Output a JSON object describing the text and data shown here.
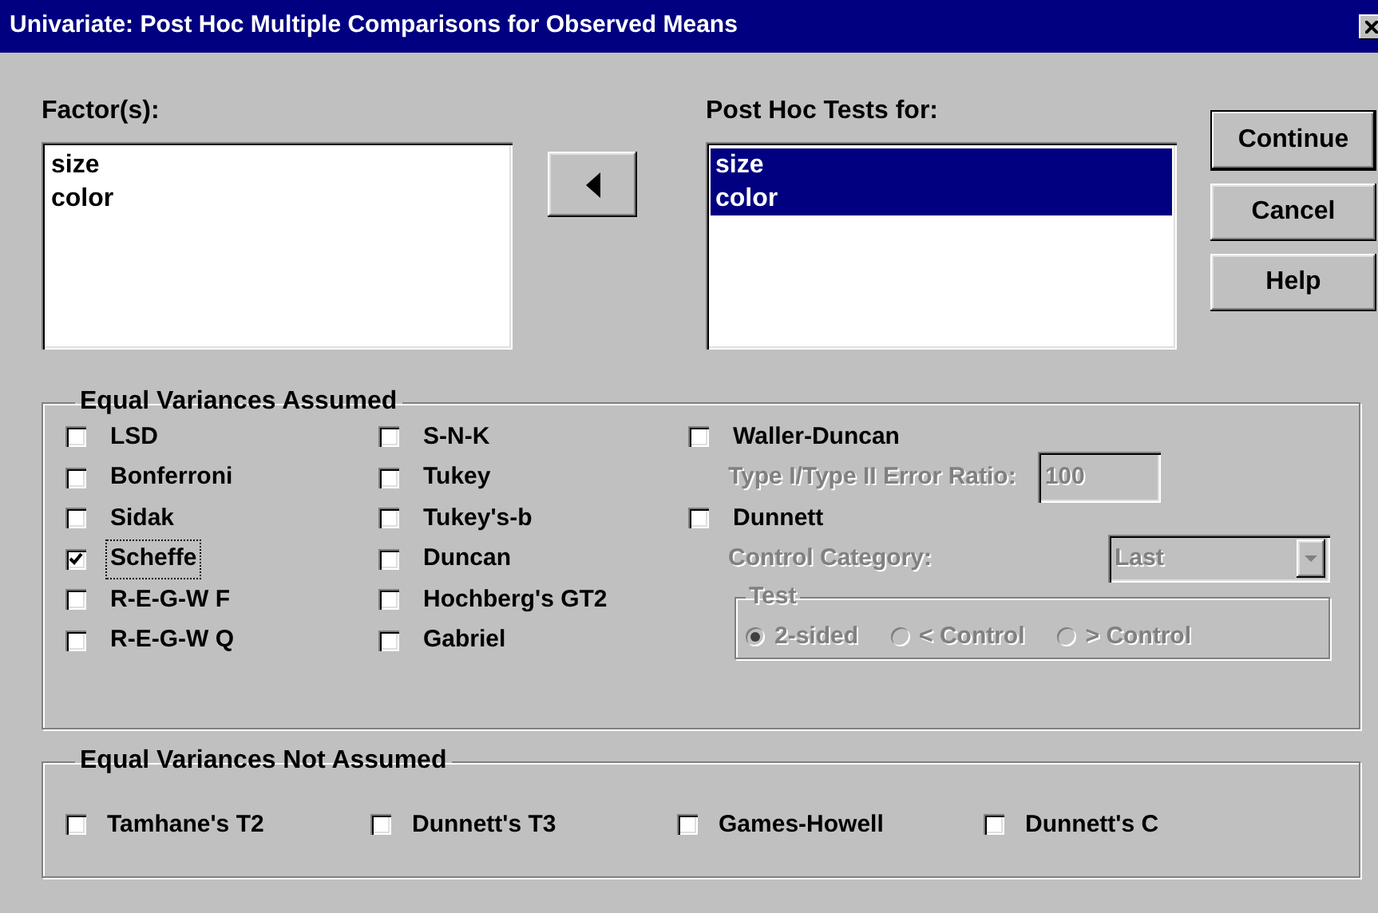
{
  "window": {
    "title": "Univariate: Post Hoc Multiple Comparisons for Observed Means"
  },
  "factors": {
    "label": "Factor(s):",
    "items": [
      {
        "text": "size",
        "selected": false
      },
      {
        "text": "color",
        "selected": false
      }
    ]
  },
  "post_hoc": {
    "label": "Post Hoc Tests for:",
    "items": [
      {
        "text": "size",
        "selected": true
      },
      {
        "text": "color",
        "selected": true
      }
    ]
  },
  "buttons": [
    "Continue",
    "Cancel",
    "Help"
  ],
  "equal_variances_assumed": {
    "title": "Equal Variances Assumed",
    "columns": [
      [
        {
          "label": "LSD",
          "checked": false,
          "focused": false
        },
        {
          "label": "Bonferroni",
          "checked": false,
          "focused": false
        },
        {
          "label": "Sidak",
          "checked": false,
          "focused": false
        },
        {
          "label": "Scheffe",
          "checked": true,
          "focused": true
        },
        {
          "label": "R-E-G-W F",
          "checked": false,
          "focused": false
        },
        {
          "label": "R-E-G-W Q",
          "checked": false,
          "focused": false
        }
      ],
      [
        {
          "label": "S-N-K",
          "checked": false,
          "focused": false
        },
        {
          "label": "Tukey",
          "checked": false,
          "focused": false
        },
        {
          "label": "Tukey's-b",
          "checked": false,
          "focused": false
        },
        {
          "label": "Duncan",
          "checked": false,
          "focused": false
        },
        {
          "label": "Hochberg's GT2",
          "checked": false,
          "focused": false
        },
        {
          "label": "Gabriel",
          "checked": false,
          "focused": false
        }
      ]
    ],
    "waller_duncan": {
      "label": "Waller-Duncan",
      "checked": false,
      "options_disabled": true,
      "ratio_label": "Type I/Type II Error Ratio:",
      "ratio_value": "100"
    },
    "dunnett": {
      "label": "Dunnett",
      "checked": false,
      "options_disabled": true,
      "category_label": "Control Category:",
      "category_value": "Last",
      "test_title": "Test",
      "tests": [
        {
          "label": "2-sided",
          "selected": true
        },
        {
          "label": "< Control",
          "selected": false
        },
        {
          "label": "> Control",
          "selected": false
        }
      ]
    }
  },
  "equal_variances_not_assumed": {
    "title": "Equal Variances Not Assumed",
    "items": [
      {
        "label": "Tamhane's T2",
        "checked": false
      },
      {
        "label": "Dunnett's T3",
        "checked": false
      },
      {
        "label": "Games-Howell",
        "checked": false
      },
      {
        "label": "Dunnett's C",
        "checked": false
      }
    ]
  }
}
